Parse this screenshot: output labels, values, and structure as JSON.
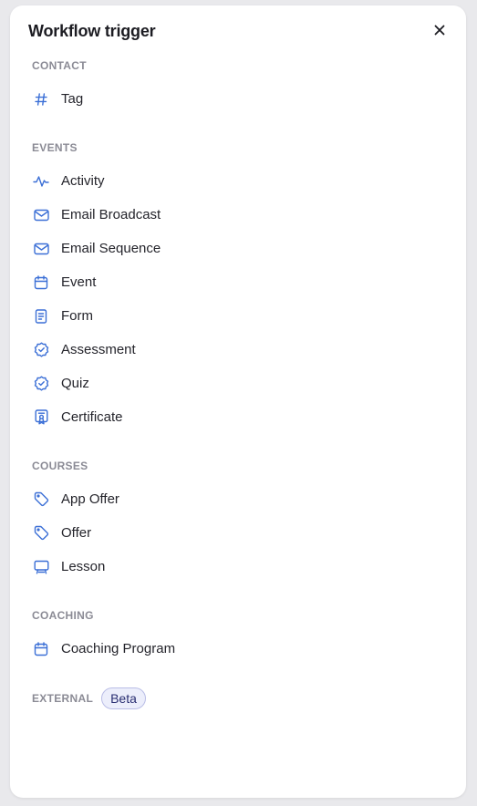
{
  "dialog": {
    "title": "Workflow trigger"
  },
  "colors": {
    "icon": "#3b6fd6",
    "section_label": "#8b8b95",
    "badge_bg": "#eceefb",
    "badge_border": "#b9bde6"
  },
  "sections": {
    "contact": {
      "label": "CONTACT",
      "items": [
        {
          "label": "Tag",
          "icon": "hash-icon"
        }
      ]
    },
    "events": {
      "label": "EVENTS",
      "items": [
        {
          "label": "Activity",
          "icon": "activity-icon"
        },
        {
          "label": "Email Broadcast",
          "icon": "mail-icon"
        },
        {
          "label": "Email Sequence",
          "icon": "mail-icon"
        },
        {
          "label": "Event",
          "icon": "calendar-icon"
        },
        {
          "label": "Form",
          "icon": "form-icon"
        },
        {
          "label": "Assessment",
          "icon": "badge-check-icon"
        },
        {
          "label": "Quiz",
          "icon": "badge-check-icon"
        },
        {
          "label": "Certificate",
          "icon": "certificate-icon"
        }
      ]
    },
    "courses": {
      "label": "COURSES",
      "items": [
        {
          "label": "App Offer",
          "icon": "tag-icon"
        },
        {
          "label": "Offer",
          "icon": "tag-icon"
        },
        {
          "label": "Lesson",
          "icon": "presentation-icon"
        }
      ]
    },
    "coaching": {
      "label": "COACHING",
      "items": [
        {
          "label": "Coaching Program",
          "icon": "calendar-icon"
        }
      ]
    },
    "external": {
      "label": "EXTERNAL",
      "badge": "Beta"
    }
  }
}
